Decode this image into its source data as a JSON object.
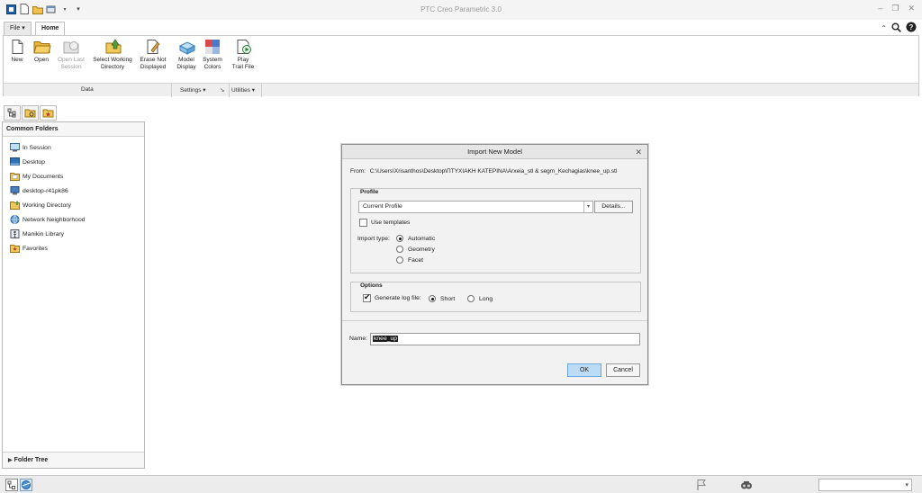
{
  "window": {
    "title": "PTC Creo Parametric 3.0",
    "controls": [
      "minimize-icon",
      "restore-icon",
      "close-icon"
    ]
  },
  "quick_access": {
    "icons": [
      "app-logo-icon",
      "new-icon",
      "open-icon",
      "window-icon",
      "dropdown-arrow-icon",
      "customize-icon"
    ]
  },
  "ribbon": {
    "tabs": [
      {
        "label": "File ▾"
      },
      {
        "label": "Home"
      }
    ],
    "buttons": [
      {
        "label": "New",
        "icon": "new-file-icon",
        "enabled": true
      },
      {
        "label": "Open",
        "icon": "open-folder-icon",
        "enabled": true
      },
      {
        "label": "Open Last\nSession",
        "icon": "last-session-icon",
        "enabled": false
      },
      {
        "label": "Select Working\nDirectory",
        "icon": "working-directory-icon",
        "enabled": true
      },
      {
        "label": "Erase Not\nDisplayed",
        "icon": "erase-icon",
        "enabled": true
      },
      {
        "label": "Model\nDisplay",
        "icon": "model-display-icon",
        "enabled": true
      },
      {
        "label": "System\nColors",
        "icon": "system-colors-icon",
        "enabled": true
      },
      {
        "label": "Play\nTrail File",
        "icon": "play-trail-icon",
        "enabled": true
      }
    ],
    "groups": [
      {
        "label": "Data"
      },
      {
        "label": "Settings ▾"
      },
      {
        "label": "Utilities ▾"
      }
    ]
  },
  "navigator": {
    "header": "Common Folders",
    "items": [
      {
        "label": "In Session",
        "icon": "in-session-icon"
      },
      {
        "label": "Desktop",
        "icon": "desktop-icon"
      },
      {
        "label": "My Documents",
        "icon": "documents-icon"
      },
      {
        "label": "desktop-r41pk86",
        "icon": "computer-icon"
      },
      {
        "label": "Working Directory",
        "icon": "working-folder-icon"
      },
      {
        "label": "Network Neighborhood",
        "icon": "network-icon"
      },
      {
        "label": "Manikin Library",
        "icon": "manikin-library-icon"
      },
      {
        "label": "Favorites",
        "icon": "favorites-icon"
      }
    ],
    "folder_tree": "Folder Tree"
  },
  "dialog": {
    "title": "Import New Model",
    "from_label": "From:",
    "from_path": "C:\\Users\\Xrisanthos\\Desktop\\ΠΤΥΧΙΑΚΗ ΚΑΤΕΡΙΝΑ\\Arxeia_stl & segm_Kechagias\\knee_up.stl",
    "profile": {
      "legend": "Profile",
      "selected": "Current Profile",
      "details_button": "Details...",
      "use_templates_label": "Use templates",
      "use_templates_checked": false,
      "import_type_label": "Import type:",
      "import_types": [
        {
          "label": "Automatic",
          "selected": true
        },
        {
          "label": "Geometry",
          "selected": false
        },
        {
          "label": "Facet",
          "selected": false
        }
      ]
    },
    "options": {
      "legend": "Options",
      "generate_log_label": "Generate log file:",
      "generate_log_checked": true,
      "log_types": [
        {
          "label": "Short",
          "selected": true
        },
        {
          "label": "Long",
          "selected": false
        }
      ]
    },
    "name_label": "Name:",
    "name_value": "knee_up",
    "ok_button": "OK",
    "cancel_button": "Cancel"
  },
  "colors": {
    "ok_button": "#bcdcf5",
    "accent": "#4a90d9"
  }
}
